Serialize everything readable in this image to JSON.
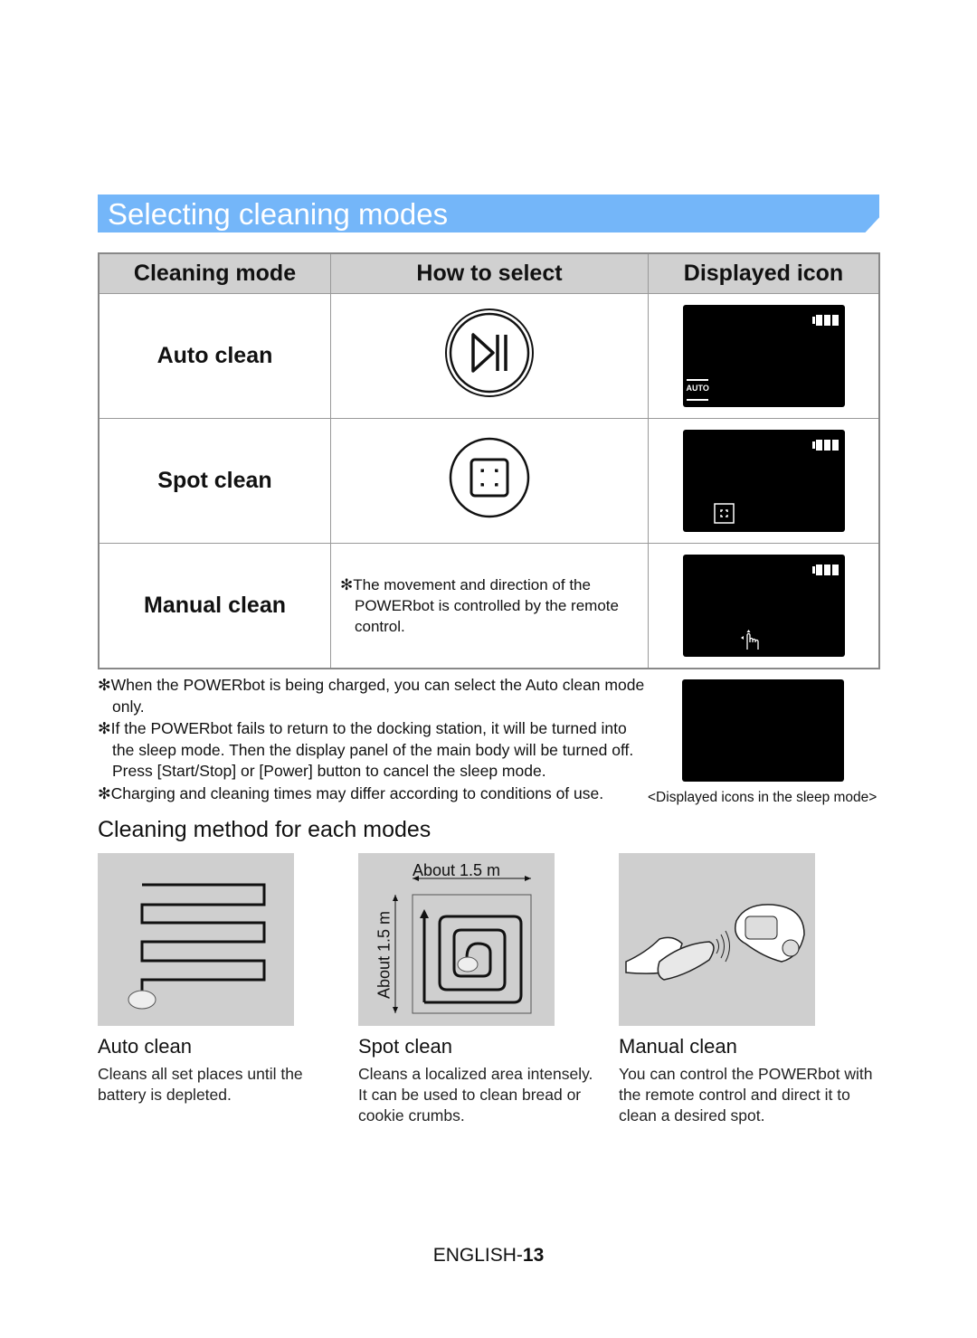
{
  "title": "Selecting cleaning modes",
  "table": {
    "headers": [
      "Cleaning mode",
      "How to select",
      "Displayed icon"
    ],
    "rows": [
      {
        "mode": "Auto clean",
        "select_icon": "start-stop-button-icon",
        "display_icon": "auto-icon",
        "display_label": "AUTO"
      },
      {
        "mode": "Spot clean",
        "select_icon": "spot-button-icon",
        "display_icon": "spot-icon"
      },
      {
        "mode": "Manual clean",
        "select_text": "The movement and direction of the POWERbot is controlled by the remote control.",
        "display_icon": "manual-hand-icon"
      }
    ]
  },
  "notes": [
    "When the POWERbot is being charged, you can select the Auto clean mode only.",
    "If the POWERbot fails to return to the docking station, it will be turned into the sleep mode. Then the display panel of the main body will be turned off. Press [Start/Stop] or [Power] button to cancel the sleep mode.",
    "Charging and cleaning times may differ according to conditions of use."
  ],
  "note_marker": "✻",
  "sleep_caption": "<Displayed icons in the sleep mode>",
  "section2_title": "Cleaning method for each modes",
  "methods": [
    {
      "title": "Auto clean",
      "text": "Cleans all set places until the battery is depleted."
    },
    {
      "title": "Spot clean",
      "text": "Cleans a localized area intensely. It can be used to clean bread or cookie crumbs.",
      "dim_h": "About 1.5 m",
      "dim_v": "About 1.5 m"
    },
    {
      "title": "Manual clean",
      "text": "You can control the POWERbot with the remote control and direct it to clean a desired spot."
    }
  ],
  "footer": {
    "prefix": "ENGLISH-",
    "page": "13"
  },
  "colors": {
    "title_bar": "#74b6f9",
    "header_bg": "#d0d0d0",
    "image_bg": "#cfcfcf"
  }
}
